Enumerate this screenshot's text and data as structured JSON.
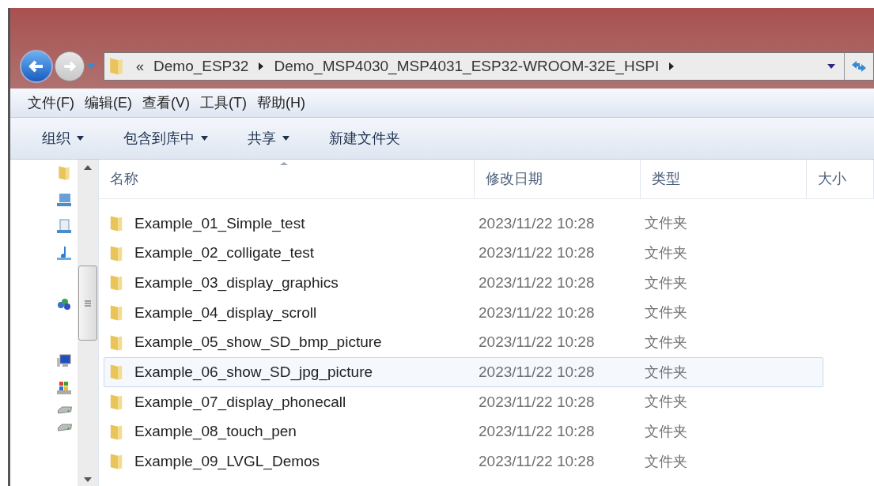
{
  "address_bar": {
    "overflow": "«",
    "crumbs": [
      "Demo_ESP32",
      "Demo_MSP4030_MSP4031_ESP32-WROOM-32E_HSPI"
    ]
  },
  "menu_bar": [
    "文件(F)",
    "编辑(E)",
    "查看(V)",
    "工具(T)",
    "帮助(H)"
  ],
  "toolbar": [
    {
      "label": "组织",
      "dropdown": true
    },
    {
      "label": "包含到库中",
      "dropdown": true
    },
    {
      "label": "共享",
      "dropdown": true
    },
    {
      "label": "新建文件夹",
      "dropdown": false
    }
  ],
  "table": {
    "columns": [
      "名称",
      "修改日期",
      "类型",
      "大小"
    ],
    "rows": [
      {
        "name": "Example_01_Simple_test",
        "date": "2023/11/22 10:28",
        "type": "文件夹",
        "selected": false
      },
      {
        "name": "Example_02_colligate_test",
        "date": "2023/11/22 10:28",
        "type": "文件夹",
        "selected": false
      },
      {
        "name": "Example_03_display_graphics",
        "date": "2023/11/22 10:28",
        "type": "文件夹",
        "selected": false
      },
      {
        "name": "Example_04_display_scroll",
        "date": "2023/11/22 10:28",
        "type": "文件夹",
        "selected": false
      },
      {
        "name": "Example_05_show_SD_bmp_picture",
        "date": "2023/11/22 10:28",
        "type": "文件夹",
        "selected": false
      },
      {
        "name": "Example_06_show_SD_jpg_picture",
        "date": "2023/11/22 10:28",
        "type": "文件夹",
        "selected": true
      },
      {
        "name": "Example_07_display_phonecall",
        "date": "2023/11/22 10:28",
        "type": "文件夹",
        "selected": false
      },
      {
        "name": "Example_08_touch_pen",
        "date": "2023/11/22 10:28",
        "type": "文件夹",
        "selected": false
      },
      {
        "name": "Example_09_LVGL_Demos",
        "date": "2023/11/22 10:28",
        "type": "文件夹",
        "selected": false
      }
    ]
  }
}
